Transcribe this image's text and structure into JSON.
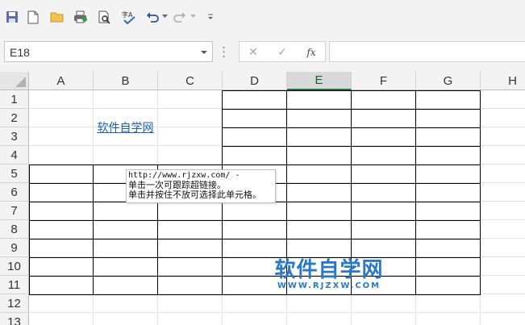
{
  "toolbar": {
    "items": [
      "save-icon",
      "new-document-icon",
      "open-folder-icon",
      "print-icon",
      "print-preview-icon",
      "spelling-icon",
      "undo-icon",
      "redo-icon",
      "customize-toolbar-icon"
    ]
  },
  "name_box": {
    "value": "E18"
  },
  "formula_bar": {
    "cancel_symbol": "✕",
    "enter_symbol": "✓",
    "function_label": "fx",
    "value": ""
  },
  "columns": [
    "A",
    "B",
    "C",
    "D",
    "E",
    "F",
    "G",
    "H"
  ],
  "active_column": "E",
  "rows": [
    "1",
    "2",
    "3",
    "4",
    "5",
    "6",
    "7",
    "8",
    "9",
    "10",
    "11",
    "12",
    "13"
  ],
  "cells": {
    "A1": {
      "text": "软件自学网",
      "type": "hyperlink",
      "merged": "A1:C4"
    }
  },
  "tooltip": {
    "lines": [
      "http://www.rjzxw.com/ -",
      "单击一次可跟踪超链接。",
      "单击并按住不放可选择此单元格。"
    ]
  },
  "watermark": {
    "title": "软件自学网",
    "url": "WWW.RJZXW.COM"
  },
  "colors": {
    "accent": "#217346",
    "link": "#1b5fb3",
    "watermark": "#2a79c7"
  }
}
